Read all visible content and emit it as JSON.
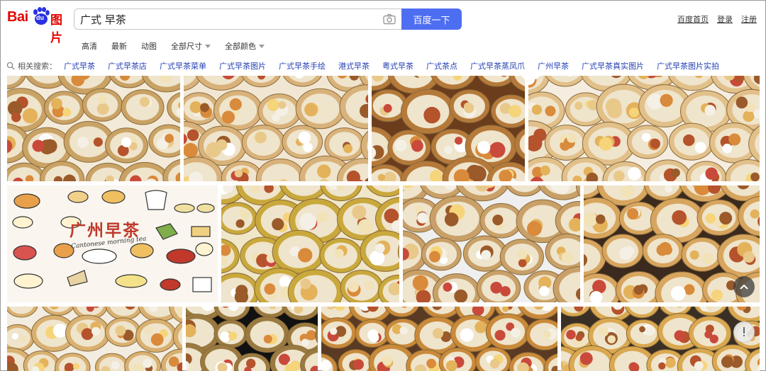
{
  "logo": {
    "text_bai": "Bai",
    "text_du": "du",
    "text_tupian": "图片",
    "brand_color": "#e10602"
  },
  "search": {
    "query": "广式 早茶",
    "button_label": "百度一下",
    "camera_icon": "camera-icon"
  },
  "top_links": [
    "百度首页",
    "登录",
    "注册"
  ],
  "filters": [
    {
      "label": "高清",
      "dropdown": false
    },
    {
      "label": "最新",
      "dropdown": false
    },
    {
      "label": "动图",
      "dropdown": false
    },
    {
      "label": "全部尺寸",
      "dropdown": true
    },
    {
      "label": "全部颜色",
      "dropdown": true
    }
  ],
  "related": {
    "label": "相关搜索：",
    "terms": [
      "广式早茶",
      "广式早茶店",
      "广式早茶菜单",
      "广式早茶图片",
      "广式早茶手绘",
      "港式早茶",
      "粤式早茶",
      "广式茶点",
      "广式早茶蒸凤爪",
      "广州早茶",
      "广式早茶真实图片",
      "广式早茶图片实拍"
    ]
  },
  "illustration": {
    "title": "广州早茶",
    "subtitle": "Cantonese morning tea"
  },
  "controls": {
    "scroll_top_icon": "chevron-up-icon",
    "feedback_icon": "exclamation-icon"
  },
  "colors": {
    "accent": "#4e6ef2",
    "link": "#2440b3"
  }
}
